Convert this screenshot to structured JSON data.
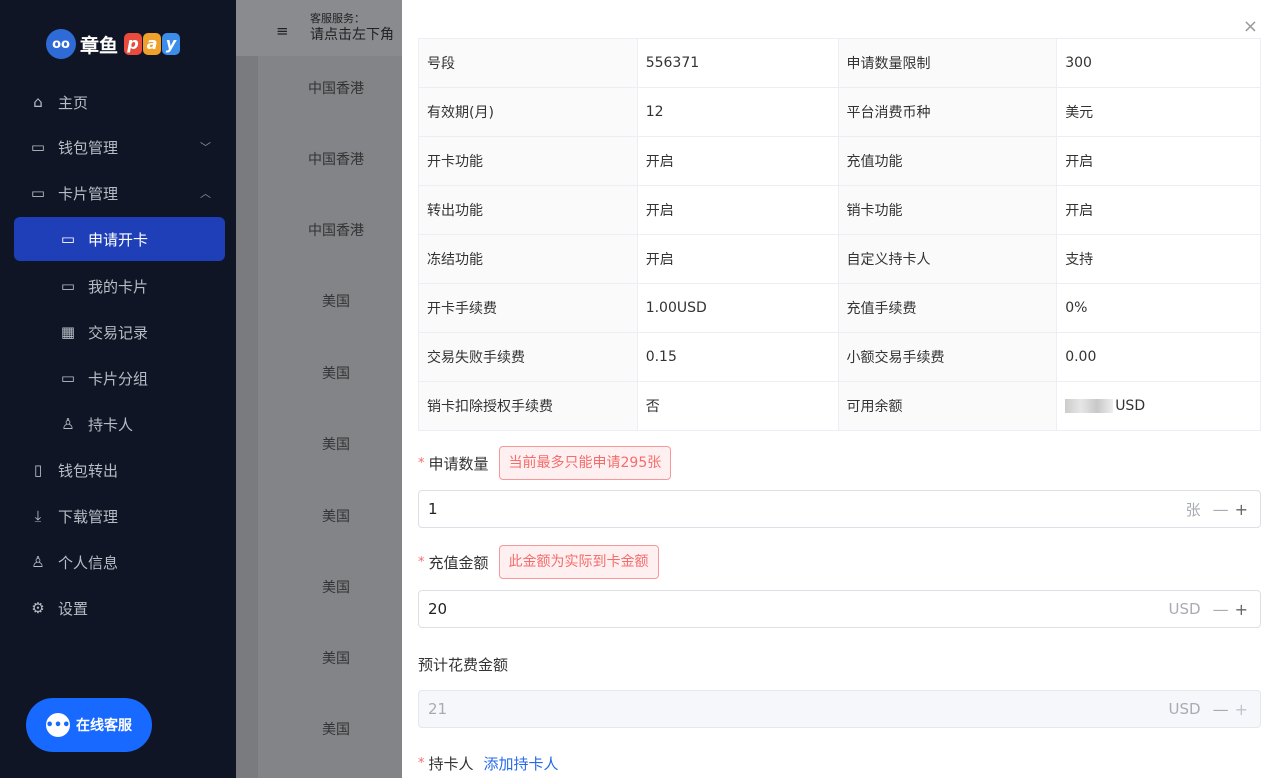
{
  "sidebar": {
    "logo_icon": "oo",
    "logo_text": "章鱼",
    "logo_pay": [
      "p",
      "a",
      "y"
    ],
    "logo_pay_colors": [
      "#e94b3c",
      "#f0a12b",
      "#3c8de9"
    ],
    "items": [
      {
        "label": "主页",
        "icon": "home-icon",
        "glyph": "⌂"
      },
      {
        "label": "钱包管理",
        "icon": "wallet-icon",
        "glyph": "▭",
        "chevron": "﹀"
      },
      {
        "label": "卡片管理",
        "icon": "card-icon",
        "glyph": "▭",
        "chevron": "︿"
      },
      {
        "label": "申请开卡",
        "icon": "card-apply-icon",
        "glyph": "▭"
      },
      {
        "label": "我的卡片",
        "icon": "cards-icon",
        "glyph": "▭"
      },
      {
        "label": "交易记录",
        "icon": "table-icon",
        "glyph": "▦"
      },
      {
        "label": "卡片分组",
        "icon": "card-group-icon",
        "glyph": "▭"
      },
      {
        "label": "持卡人",
        "icon": "cardholder-icon",
        "glyph": "♙"
      },
      {
        "label": "钱包转出",
        "icon": "transfer-icon",
        "glyph": "▯"
      },
      {
        "label": "下载管理",
        "icon": "download-icon",
        "glyph": "⤓"
      },
      {
        "label": "个人信息",
        "icon": "user-icon",
        "glyph": "♙"
      },
      {
        "label": "设置",
        "icon": "settings-icon",
        "glyph": "⚙"
      }
    ],
    "chat_button": "在线客服"
  },
  "background": {
    "menu_glyph": "≡",
    "service_label": "客服服务：",
    "service_text": "请点击左下角",
    "rows": [
      "中国香港",
      "中国香港",
      "中国香港",
      "美国",
      "美国",
      "美国",
      "美国",
      "美国",
      "美国",
      "美国"
    ]
  },
  "drawer": {
    "close": "×",
    "table": [
      [
        "号段",
        "556371",
        "申请数量限制",
        "300"
      ],
      [
        "有效期(月)",
        "12",
        "平台消费币种",
        "美元"
      ],
      [
        "开卡功能",
        "开启",
        "充值功能",
        "开启"
      ],
      [
        "转出功能",
        "开启",
        "销卡功能",
        "开启"
      ],
      [
        "冻结功能",
        "开启",
        "自定义持卡人",
        "支持"
      ],
      [
        "开卡手续费",
        "1.00USD",
        "充值手续费",
        "0%"
      ],
      [
        "交易失败手续费",
        "0.15",
        "小额交易手续费",
        "0.00"
      ],
      [
        "销卡扣除授权手续费",
        "否",
        "可用余额",
        "USD"
      ]
    ],
    "quantity": {
      "label": "申请数量",
      "tag": "当前最多只能申请295张",
      "value": "1",
      "unit": "张"
    },
    "amount": {
      "label": "充值金额",
      "tag": "此金额为实际到卡金额",
      "value": "20",
      "unit": "USD"
    },
    "estimated": {
      "label": "预计花费金额",
      "value": "21",
      "unit": "USD"
    },
    "cardholder": {
      "label": "持卡人",
      "link": "添加持卡人"
    },
    "minus": "—",
    "plus": "+",
    "required_mark": "*"
  }
}
